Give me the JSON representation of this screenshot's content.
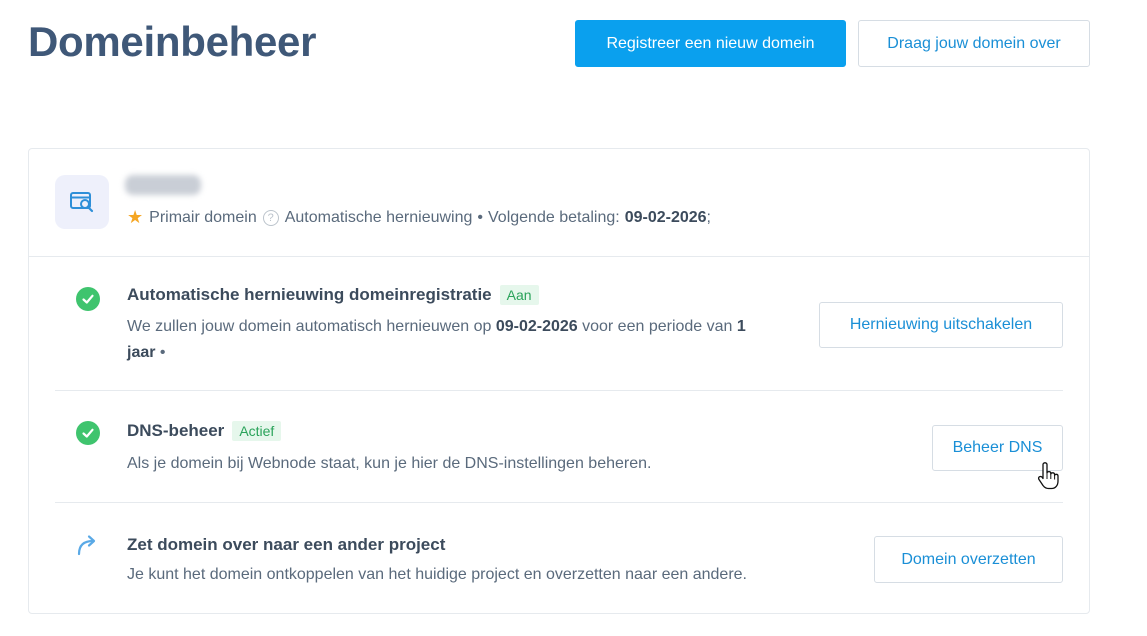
{
  "header": {
    "title": "Domeinbeheer",
    "register_button": "Registreer een nieuw domein",
    "transfer_button": "Draag jouw domein over"
  },
  "domain": {
    "primary_label": "Primair domein",
    "renewal_info": "Automatische hernieuwing",
    "next_payment_label": "Volgende betaling:",
    "next_payment_date": "09-02-2026",
    "separator": "•",
    "trailing": ";"
  },
  "rows": [
    {
      "title": "Automatische hernieuwing domeinregistratie",
      "badge": "Aan",
      "desc_prefix": "We zullen jouw domein automatisch hernieuwen op ",
      "desc_date": "09-02-2026",
      "desc_mid": " voor een periode van ",
      "desc_period": "1 jaar",
      "desc_suffix": " •",
      "button": "Hernieuwing uitschakelen"
    },
    {
      "title": "DNS-beheer",
      "badge": "Actief",
      "desc": "Als je domein bij Webnode staat, kun je hier de DNS-instellingen beheren.",
      "button": "Beheer DNS"
    },
    {
      "title": "Zet domein over naar een ander project",
      "desc": "Je kunt het domein ontkoppelen van het huidige project en overzetten naar een andere.",
      "button": "Domein overzetten"
    }
  ],
  "icons": {
    "domain": "domain-search-icon",
    "star": "star-icon",
    "help": "help-circle-icon",
    "check": "check-circle-icon",
    "move": "arrow-redirect-icon",
    "cursor": "hand-pointer-icon"
  },
  "colors": {
    "primary": "#0aa0ee",
    "title": "#3f5878",
    "success": "#3fc46e",
    "star": "#f5a623"
  }
}
